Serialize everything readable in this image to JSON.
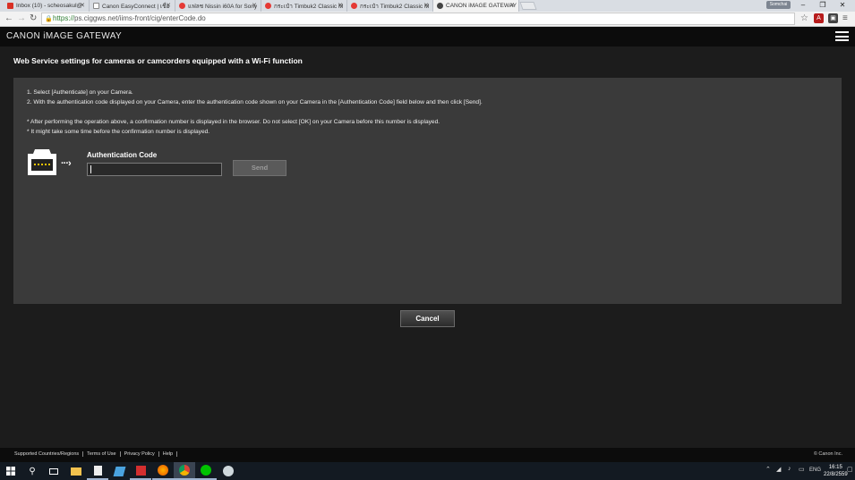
{
  "browser": {
    "tabs": [
      {
        "label": "Inbox (10) - scheosakul@",
        "fav_color": "#d93025"
      },
      {
        "label": "Canon EasyConnect | เชื่อ",
        "fav_color": "#5f6368"
      },
      {
        "label": "แฟลช Nissin i60A for Sony",
        "fav_color": "#e53935"
      },
      {
        "label": "กระเป๋า Timbuk2 Classic M",
        "fav_color": "#e53935"
      },
      {
        "label": "กระเป๋า Timbuk2 Classic M",
        "fav_color": "#e53935"
      },
      {
        "label": "CANON iMAGE GATEWAY",
        "fav_color": "#444444"
      }
    ],
    "url_scheme": "https://",
    "url_rest": "ps.ciggws.net/iims-front/cig/enterCode.do",
    "window_badge": "Somchai"
  },
  "site": {
    "logo": "CANON iMAGE GATEWAY",
    "page_title": "Web Service settings for cameras or camcorders equipped with a Wi-Fi function",
    "instructions": [
      "1. Select [Authenticate] on your Camera.",
      "2. With the authentication code displayed on your Camera, enter the authentication code shown on your Camera in the [Authentication Code] field below and then click [Send].",
      "* After performing the operation above, a confirmation number is displayed in the browser. Do not select [OK] on your Camera before this number is displayed.",
      "* It might take some time before the confirmation number is displayed."
    ],
    "auth_label": "Authentication Code",
    "auth_value": "",
    "send_label": "Send",
    "cancel_label": "Cancel"
  },
  "footer": {
    "links": [
      "Supported Countries/Regions",
      "Terms of Use",
      "Privacy Policy",
      "Help"
    ],
    "copyright": "© Canon Inc."
  },
  "taskbar": {
    "lang": "ENG",
    "time": "16:15",
    "date": "22/8/2559"
  }
}
